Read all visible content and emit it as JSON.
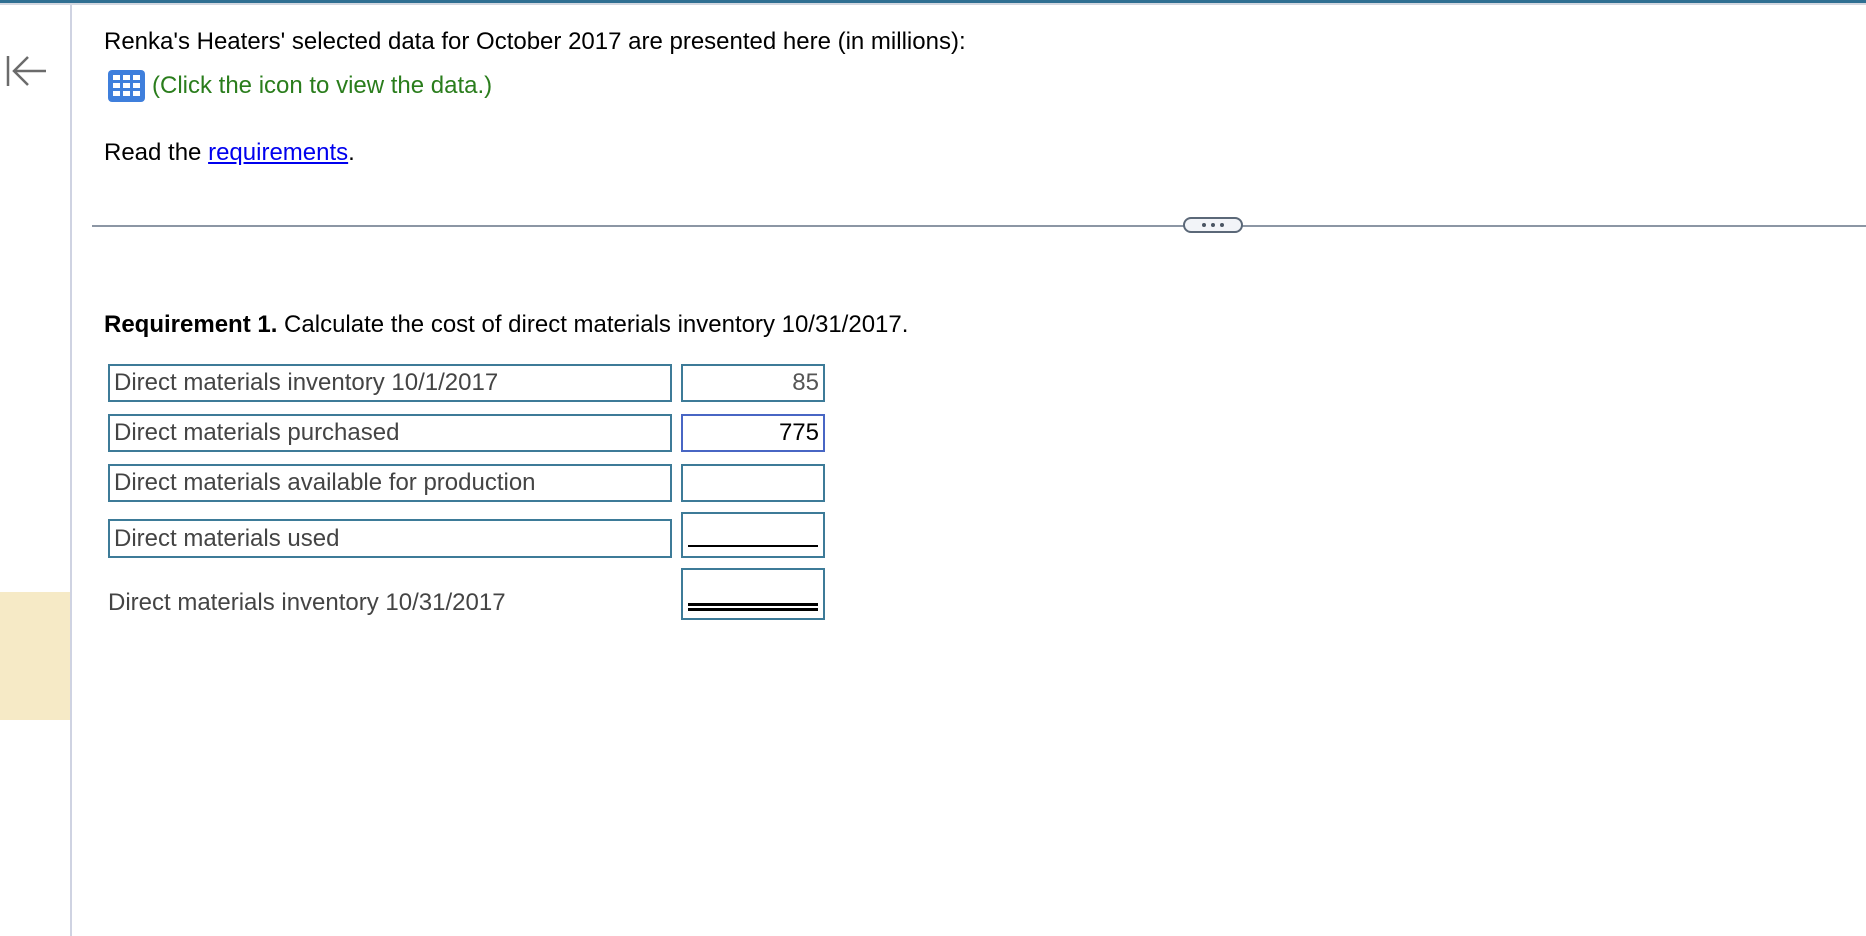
{
  "intro": {
    "text": "Renka's Heaters' selected data for October 2017 are presented here (in millions):",
    "data_link_icon": "table-grid-icon",
    "data_link_text": "(Click the icon to view the data.)",
    "read_prefix": "Read the ",
    "requirements_link": "requirements",
    "read_suffix": "."
  },
  "nav": {
    "back_icon": "collapse-left-arrow-icon"
  },
  "divider": {
    "more_icon": "ellipsis-icon"
  },
  "requirement": {
    "label": "Requirement 1.",
    "text": " Calculate the cost of direct materials inventory 10/31/2017."
  },
  "rows": [
    {
      "label": "Direct materials inventory 10/1/2017",
      "value": "85",
      "underline": "none"
    },
    {
      "label": "Direct materials purchased",
      "value": "775",
      "underline": "none"
    },
    {
      "label": "Direct materials available for production",
      "value": "",
      "underline": "none"
    },
    {
      "label": "Direct materials used",
      "value": "",
      "underline": "single"
    },
    {
      "label": "Direct materials inventory 10/31/2017",
      "value": "",
      "underline": "double"
    }
  ],
  "colors": {
    "topbar": "#2f6f92",
    "input_border": "#3d7b98",
    "active_border": "#4866c4",
    "link": "#0000ee",
    "data_link": "#2a7d1c",
    "highlight": "#f6eac6"
  }
}
